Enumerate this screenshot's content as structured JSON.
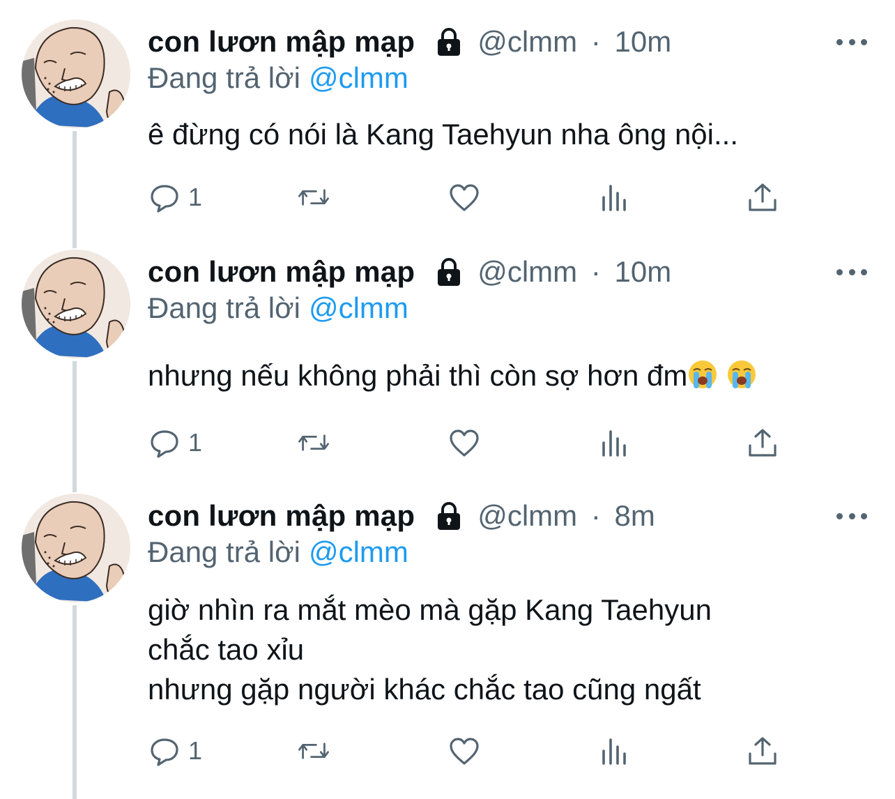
{
  "tweets": [
    {
      "name": "con lươn mập mạp",
      "handle": "@clmm",
      "time": "10m",
      "replying_prefix": "Đang trả lời",
      "replying_to": "@clmm",
      "text": "ê đừng có nói là Kang Taehyun nha ông nội...",
      "reply_count": "1"
    },
    {
      "name": "con lươn mập mạp",
      "handle": "@clmm",
      "time": "10m",
      "replying_prefix": "Đang trả lời",
      "replying_to": "@clmm",
      "text": "nhưng nếu không phải thì còn sợ hơn đm",
      "reply_count": "1"
    },
    {
      "name": "con lươn mập mạp",
      "handle": "@clmm",
      "time": "8m",
      "replying_prefix": "Đang trả lời",
      "replying_to": "@clmm",
      "text": "giờ nhìn ra mắt mèo mà gặp Kang Taehyun\nchắc tao xỉu\nnhưng gặp người khác chắc tao cũng ngất",
      "reply_count": "1"
    }
  ],
  "separator": "·",
  "icons": {
    "lock": "lock-icon",
    "more": "more-icon",
    "reply": "reply-icon",
    "retweet": "retweet-icon",
    "like": "like-icon",
    "views": "views-icon",
    "share": "share-icon",
    "emoji": "loudly-crying-face-emoji"
  },
  "colors": {
    "text": "#0f1419",
    "secondary": "#536471",
    "accent": "#1d9bf0",
    "thread_line": "#cfd9de"
  }
}
